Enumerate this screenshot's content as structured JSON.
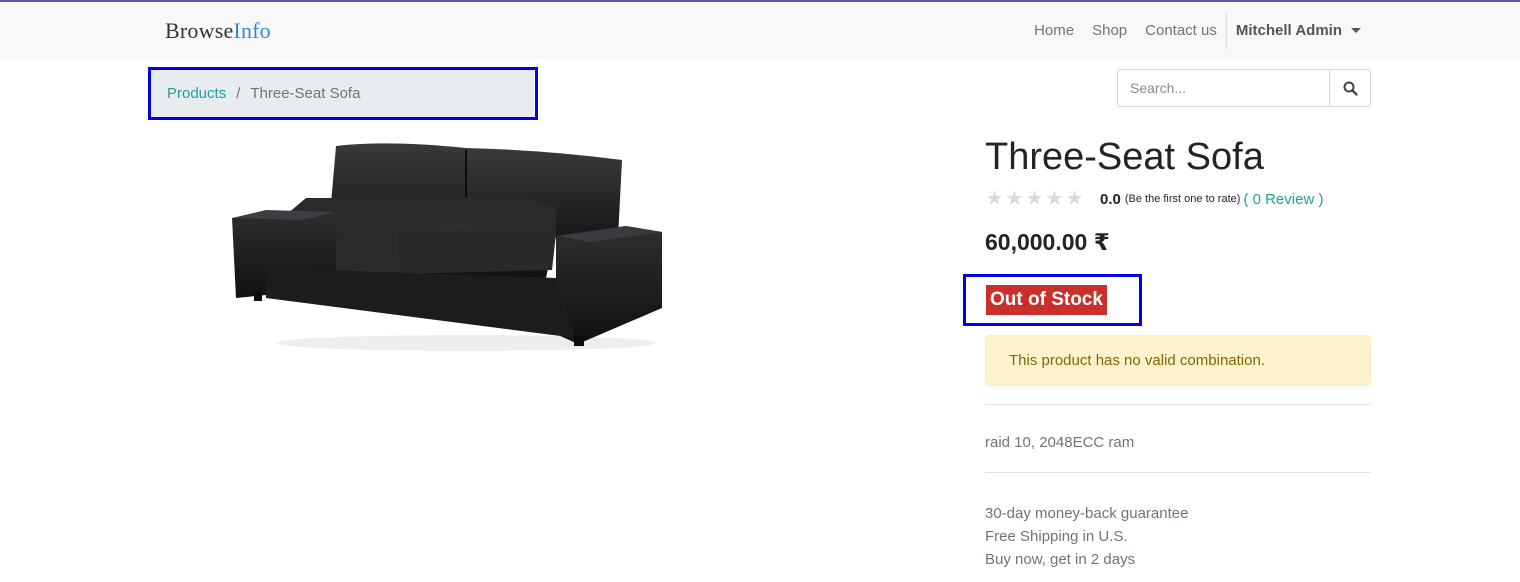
{
  "header": {
    "brand_part1": "Browse",
    "brand_part2": "Info",
    "nav": [
      "Home",
      "Shop",
      "Contact us"
    ],
    "user": "Mitchell Admin"
  },
  "breadcrumb": {
    "parent": "Products",
    "separator": "/",
    "current": "Three-Seat Sofa"
  },
  "search": {
    "placeholder": "Search..."
  },
  "product": {
    "title": "Three-Seat Sofa",
    "rating_value": "0.0",
    "rating_note": "(Be the first one to rate)",
    "review_link": "( 0 Review )",
    "stars_filled": 0,
    "stars_total": 5,
    "price": "60,000.00 ₹",
    "stock_badge": "Out of Stock",
    "alert": "This product has no valid combination.",
    "description": "raid 10, 2048ECC ram",
    "guarantee_lines": [
      "30-day money-back guarantee",
      "Free Shipping in U.S.",
      "Buy now, get in 2 days"
    ]
  },
  "colors": {
    "accent": "#21a0a0",
    "brand_blue": "#2f8bd4",
    "out_of_stock": "#c9302c",
    "highlight_box": "#0000e0",
    "alert_bg": "#fff3cd"
  },
  "icons": {
    "search": "search-icon",
    "user_menu": "chevron-down-icon",
    "star": "star-icon"
  }
}
